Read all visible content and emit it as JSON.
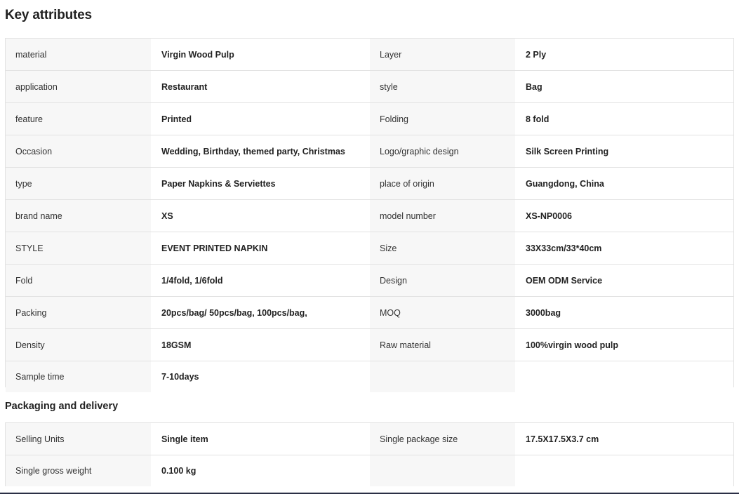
{
  "key_attributes": {
    "title": "Key attributes",
    "rows": [
      {
        "k1": "material",
        "v1": "Virgin Wood Pulp",
        "k2": "Layer",
        "v2": "2 Ply"
      },
      {
        "k1": "application",
        "v1": "Restaurant",
        "k2": "style",
        "v2": "Bag"
      },
      {
        "k1": "feature",
        "v1": "Printed",
        "k2": "Folding",
        "v2": "8 fold"
      },
      {
        "k1": "Occasion",
        "v1": "Wedding, Birthday, themed party, Christmas",
        "k2": "Logo/graphic design",
        "v2": "Silk Screen Printing"
      },
      {
        "k1": "type",
        "v1": "Paper Napkins & Serviettes",
        "k2": "place of origin",
        "v2": "Guangdong, China"
      },
      {
        "k1": "brand name",
        "v1": "XS",
        "k2": "model number",
        "v2": "XS-NP0006"
      },
      {
        "k1": "STYLE",
        "v1": "EVENT PRINTED NAPKIN",
        "k2": "Size",
        "v2": "33X33cm/33*40cm"
      },
      {
        "k1": "Fold",
        "v1": "1/4fold, 1/6fold",
        "k2": "Design",
        "v2": "OEM ODM Service"
      },
      {
        "k1": "Packing",
        "v1": "20pcs/bag/ 50pcs/bag, 100pcs/bag,",
        "k2": "MOQ",
        "v2": "3000bag"
      },
      {
        "k1": "Density",
        "v1": "18GSM",
        "k2": "Raw material",
        "v2": "100%virgin wood pulp"
      },
      {
        "k1": "Sample time",
        "v1": "7-10days",
        "k2": "",
        "v2": ""
      }
    ]
  },
  "packaging": {
    "title": "Packaging and delivery",
    "rows": [
      {
        "k1": "Selling Units",
        "v1": "Single item",
        "k2": "Single package size",
        "v2": "17.5X17.5X3.7 cm"
      },
      {
        "k1": "Single gross weight",
        "v1": "0.100 kg",
        "k2": "",
        "v2": ""
      }
    ]
  }
}
